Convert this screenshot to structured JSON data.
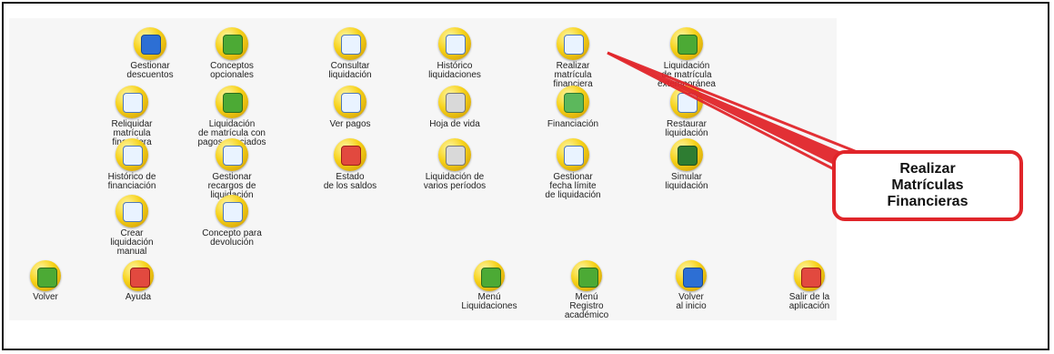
{
  "app": {
    "grid": [
      {
        "id": "gestionar_descuentos",
        "label": "Gestionar\ndescuentos",
        "icon": "discount-chart-icon"
      },
      {
        "id": "conceptos_opcionales",
        "label": "Conceptos\nopcionales",
        "icon": "concept-flow-icon"
      },
      {
        "id": "consultar_liquidacion",
        "label": "Consultar\nliquidación",
        "icon": "document-money-icon"
      },
      {
        "id": "historico_liquidaciones",
        "label": "Histórico\nliquidaciones",
        "icon": "history-document-icon"
      },
      {
        "id": "realizar_matricula_financiera",
        "label": "Realizar\nmatrícula\nfinanciera",
        "icon": "register-enrollment-icon"
      },
      {
        "id": "liquidacion_matricula_extemporanea",
        "label": "Liquidación\nde matrícula\nextemporánea",
        "icon": "late-payment-icon"
      },
      {
        "id": "reliquidar_matricula_financiera",
        "label": "Reliquidar\nmatrícula\nfinanciera",
        "icon": "recalculate-icon"
      },
      {
        "id": "liquidacion_pagos_asociados",
        "label": "Liquidación\nde matrícula con\npagos asociados",
        "icon": "linked-payments-icon"
      },
      {
        "id": "ver_pagos",
        "label": "Ver pagos",
        "icon": "view-payments-icon"
      },
      {
        "id": "hoja_de_vida",
        "label": "Hoja de vida",
        "icon": "cv-icon"
      },
      {
        "id": "financiacion",
        "label": "Financiación",
        "icon": "financing-icon"
      },
      {
        "id": "restaurar_liquidacion",
        "label": "Restaurar\nliquidación",
        "icon": "restore-icon"
      },
      {
        "id": "historico_financiacion",
        "label": "Histórico de\nfinanciación",
        "icon": "financing-history-icon"
      },
      {
        "id": "gestionar_recargos_liquidacion",
        "label": "Gestionar\nrecargos de\nliquidación",
        "icon": "surcharges-icon"
      },
      {
        "id": "estado_saldos",
        "label": "Estado\nde los saldos",
        "icon": "balance-status-icon"
      },
      {
        "id": "liquidacion_varios_periodos",
        "label": "Liquidación de\nvarios períodos",
        "icon": "multi-period-icon"
      },
      {
        "id": "gestionar_fecha_limite",
        "label": "Gestionar\nfecha límite\nde liquidación",
        "icon": "deadline-icon"
      },
      {
        "id": "simular_liquidacion",
        "label": "Simular\nliquidación",
        "icon": "simulate-icon"
      },
      {
        "id": "crear_liquidacion_manual",
        "label": "Crear\nliquidación\nmanual",
        "icon": "manual-create-icon"
      },
      {
        "id": "concepto_devolucion",
        "label": "Concepto para\ndevolución",
        "icon": "refund-concept-icon"
      }
    ],
    "bottom_nav": [
      {
        "id": "volver",
        "label": "Volver",
        "icon": "back-arrow-icon"
      },
      {
        "id": "ayuda",
        "label": "Ayuda",
        "icon": "help-lifebuoy-icon"
      },
      {
        "id": "menu_liquidaciones",
        "label": "Menú\nLiquidaciones",
        "icon": "menu-liquidations-icon"
      },
      {
        "id": "menu_registro_academico",
        "label": "Menú\nRegistro\nacadémico",
        "icon": "menu-academic-icon"
      },
      {
        "id": "volver_inicio",
        "label": "Volver\nal inicio",
        "icon": "home-m-icon"
      },
      {
        "id": "salir_aplicacion",
        "label": "Salir de la\naplicación",
        "icon": "exit-icon"
      }
    ],
    "callout": {
      "text": "Realizar\nMatrículas\nFinancieras",
      "border_color": "#e0252a"
    }
  }
}
